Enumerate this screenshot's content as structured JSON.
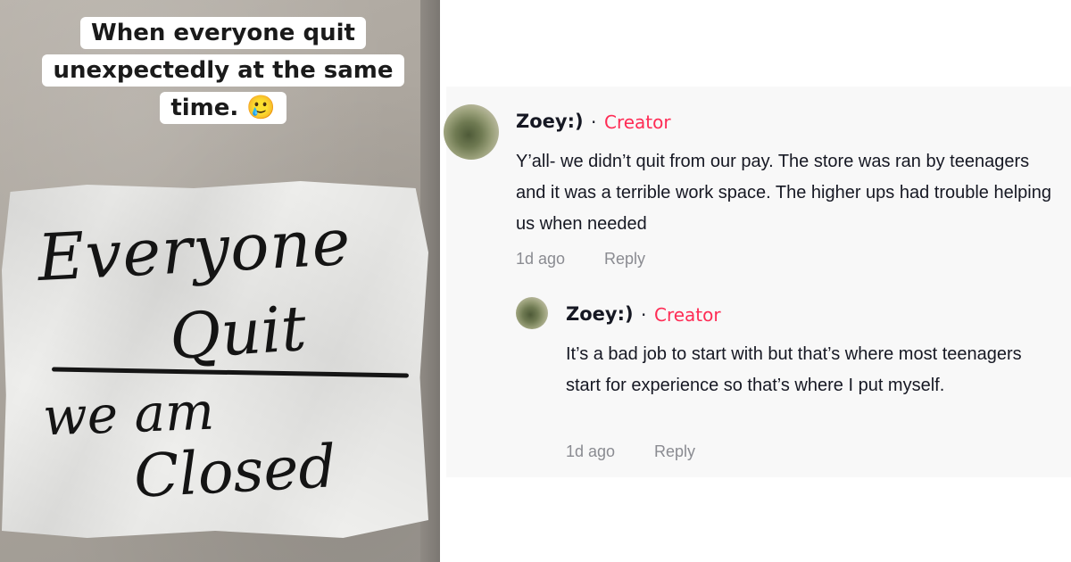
{
  "caption": {
    "lines": [
      "When everyone quit",
      "unexpectedly at the same",
      "time. 🥲"
    ]
  },
  "sign": {
    "line1": "Everyone",
    "line2": "Quit",
    "line3": "we am",
    "line4": "Closed"
  },
  "comments": [
    {
      "author": "Zoey:)",
      "separator": "·",
      "badge": "Creator",
      "text": "Y’all- we didn’t quit from our pay. The store was ran by teenagers and it was a terrible work space. The higher ups had trouble helping us when needed",
      "time": "1d ago",
      "reply_label": "Reply"
    },
    {
      "author": "Zoey:)",
      "separator": "·",
      "badge": "Creator",
      "text": "It’s a bad job to start with but that’s where most teenagers start for experience so that’s where I put myself.",
      "time": "1d ago",
      "reply_label": "Reply"
    }
  ],
  "colors": {
    "creator_badge": "#fe2c55",
    "meta_text": "#8a8b91",
    "panel_bg": "#f8f8f8"
  }
}
